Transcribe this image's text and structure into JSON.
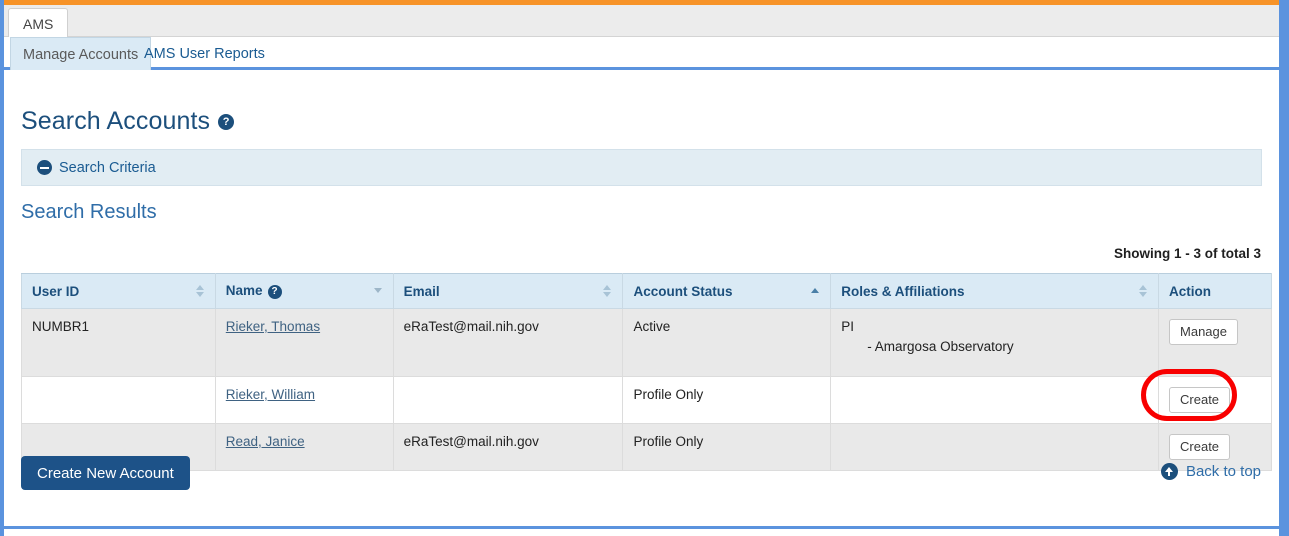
{
  "window": {
    "app_tab_label": "AMS",
    "accent_orange": "#f79328",
    "accent_blue": "#5b93de"
  },
  "subtabs": [
    {
      "label": "Manage Accounts",
      "active": true
    },
    {
      "label": "AMS User Reports",
      "active": false
    }
  ],
  "page": {
    "title": "Search Accounts",
    "title_help_icon": "help-circle-icon",
    "help_glyph": "?"
  },
  "search_criteria": {
    "label": "Search Criteria",
    "toggle_icon": "minus-circle-icon",
    "expanded": false
  },
  "results": {
    "heading": "Search Results",
    "showing": "Showing 1 - 3 of total 3",
    "columns": [
      {
        "label": "User ID",
        "sort": "none",
        "help": false
      },
      {
        "label": "Name",
        "sort": "desc",
        "help": true
      },
      {
        "label": "Email",
        "sort": "none",
        "help": false
      },
      {
        "label": "Account Status",
        "sort": "asc",
        "help": false
      },
      {
        "label": "Roles & Affiliations",
        "sort": "none",
        "help": false
      },
      {
        "label": "Action",
        "sort": null,
        "help": false
      }
    ],
    "rows": [
      {
        "user_id": "NUMBR1",
        "name": "Rieker, Thomas",
        "email": "eRaTest@mail.nih.gov",
        "status": "Active",
        "role": "PI",
        "affiliation": "- Amargosa Observatory",
        "action_label": "Manage",
        "highlighted": true
      },
      {
        "user_id": "",
        "name": "Rieker, William",
        "email": "",
        "status": "Profile Only",
        "role": "",
        "affiliation": "",
        "action_label": "Create",
        "highlighted": false
      },
      {
        "user_id": "",
        "name": "Read, Janice",
        "email": "eRaTest@mail.nih.gov",
        "status": "Profile Only",
        "role": "",
        "affiliation": "",
        "action_label": "Create",
        "highlighted": false
      }
    ]
  },
  "footer": {
    "create_account_label": "Create New Account",
    "back_to_top_label": "Back to top",
    "back_to_top_icon": "arrow-up-circle-icon"
  },
  "annotation": {
    "color": "#f80000",
    "target": "manage-button"
  }
}
